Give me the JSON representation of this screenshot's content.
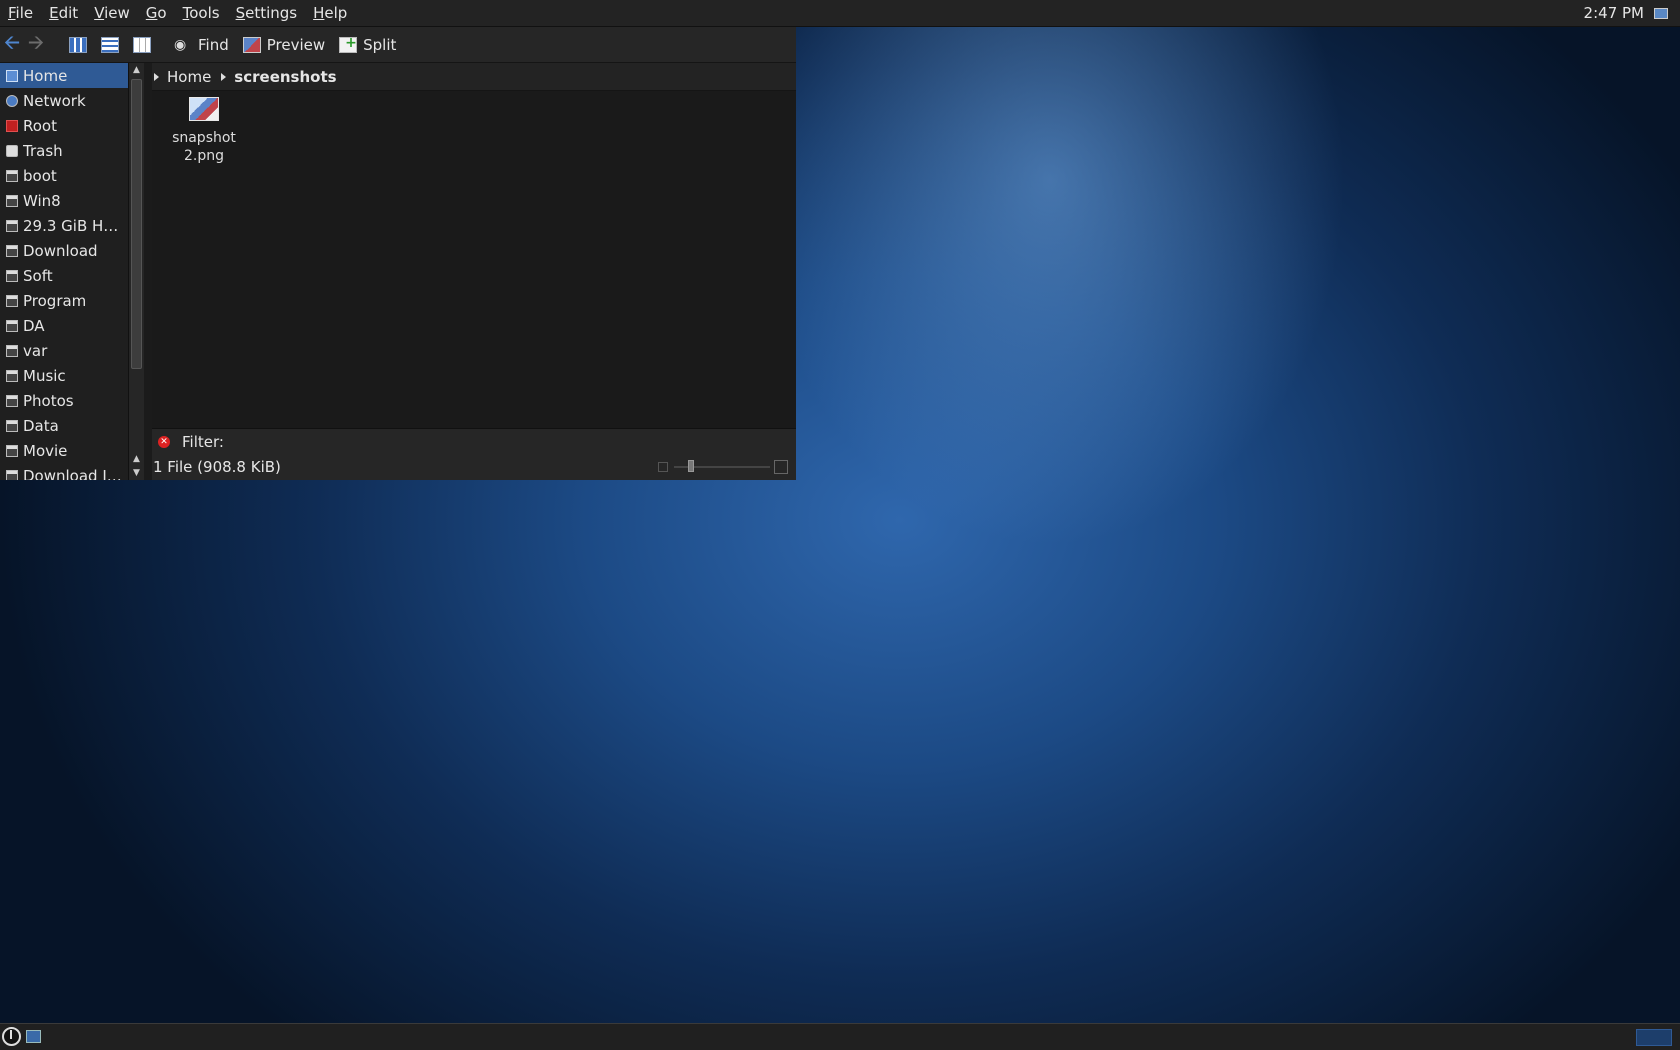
{
  "menubar": {
    "items": [
      "File",
      "Edit",
      "View",
      "Go",
      "Tools",
      "Settings",
      "Help"
    ],
    "clock": "2:47 PM"
  },
  "toolbar": {
    "find_label": "Find",
    "preview_label": "Preview",
    "split_label": "Split"
  },
  "sidebar": {
    "items": [
      {
        "label": "Home",
        "icon": "home-folder-icon"
      },
      {
        "label": "Network",
        "icon": "network-icon"
      },
      {
        "label": "Root",
        "icon": "root-folder-icon"
      },
      {
        "label": "Trash",
        "icon": "trash-icon"
      },
      {
        "label": "boot",
        "icon": "drive-icon"
      },
      {
        "label": "Win8",
        "icon": "drive-icon"
      },
      {
        "label": "29.3 GiB Har…",
        "icon": "drive-icon"
      },
      {
        "label": "Download",
        "icon": "drive-icon"
      },
      {
        "label": "Soft",
        "icon": "drive-icon"
      },
      {
        "label": "Program",
        "icon": "drive-icon"
      },
      {
        "label": "DA",
        "icon": "drive-icon"
      },
      {
        "label": "var",
        "icon": "drive-icon"
      },
      {
        "label": "Music",
        "icon": "drive-icon"
      },
      {
        "label": "Photos",
        "icon": "drive-icon"
      },
      {
        "label": "Data",
        "icon": "drive-icon"
      },
      {
        "label": "Movie",
        "icon": "drive-icon"
      },
      {
        "label": "Download I…",
        "icon": "drive-icon"
      }
    ]
  },
  "pathbar": {
    "crumbs": [
      "Home",
      "screenshots"
    ]
  },
  "files": [
    {
      "name": "snapshot2.png",
      "icon": "image-file-icon"
    }
  ],
  "filter": {
    "label": "Filter:",
    "value": ""
  },
  "status": {
    "text": "1 File (908.8 KiB)"
  },
  "colors": {
    "selection": "#2f5a95",
    "accent": "#4f86cf",
    "desktop": "#1c4a85"
  }
}
